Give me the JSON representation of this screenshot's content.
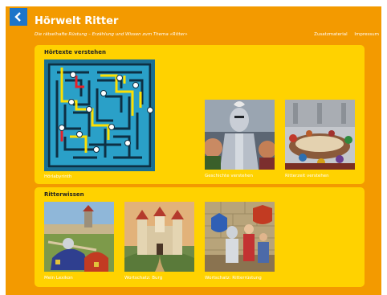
{
  "header": {
    "title": "Hörwelt Ritter",
    "subtitle": "Die rätselhafte Rüstung – Erzählung und Wissen zum Thema «Ritter»",
    "links": [
      "Zusatzmaterial",
      "Impressum"
    ]
  },
  "colors": {
    "background": "#f39a00",
    "panel": "#ffd200",
    "back_button": "#1d75c9",
    "text": "#ffffff"
  },
  "section_hoertexte": {
    "title": "Hörtexte verstehen",
    "cards": [
      {
        "label": "Hörlabyrinth",
        "icon": "maze-image"
      },
      {
        "label": "Geschichte verstehen",
        "icon": "knight-armor-image"
      },
      {
        "label": "Ritterzeit verstehen",
        "icon": "medieval-feast-image"
      }
    ]
  },
  "section_ritterwissen": {
    "title": "Ritterwissen",
    "cards": [
      {
        "label": "Mein Lexikon",
        "icon": "tournament-image"
      },
      {
        "label": "Wortschatz: Burg",
        "icon": "castle-image"
      },
      {
        "label": "Wortschatz: Ritterrüstung",
        "icon": "armor-room-image"
      }
    ]
  }
}
